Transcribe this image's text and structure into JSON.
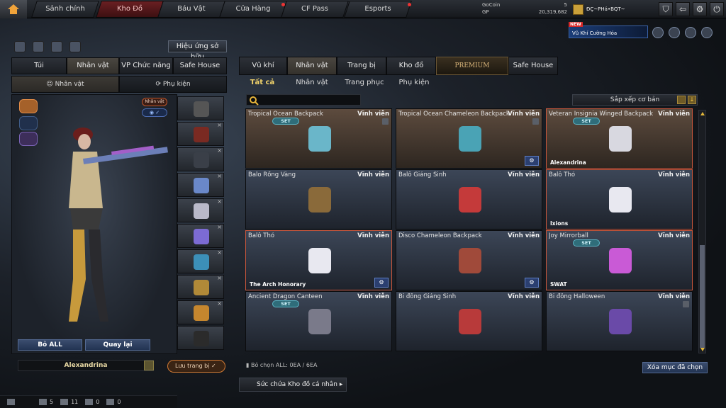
{
  "top_nav": {
    "tabs": [
      "Sảnh chính",
      "Kho Đồ",
      "Báu Vật",
      "Cửa Hàng",
      "CF Pass",
      "Esports"
    ],
    "active_tab": "Kho Đồ",
    "currency": {
      "gocoin_label": "GoCoin",
      "gocoin_value": "5",
      "gp_label": "GP",
      "gp_value": "20,319,682"
    },
    "clan": "ĐÇ~PHá•BQT~"
  },
  "promo": {
    "new_label": "NEW",
    "text": "Vũ Khí Cường Hóa"
  },
  "left_panel": {
    "effect_button": "Hiệu ứng sở hữu",
    "tabs": [
      "Túi",
      "Nhân vật",
      "VP Chức năng",
      "Safe House"
    ],
    "active_tab": "Nhân vật",
    "sub_tabs": [
      "Nhân vật",
      "Phụ kiện"
    ],
    "active_sub_tab": "Nhân vật",
    "tag_character": "Nhân vật",
    "bo_all": "Bỏ ALL",
    "quay_lai": "Quay lại",
    "character_name": "Alexandrina",
    "save_set": "Lưu trang bị"
  },
  "right_panel": {
    "tabs": [
      "Vũ khí",
      "Nhân vật",
      "Trang bị",
      "Kho đồ",
      "PREMIUM",
      "Safe House"
    ],
    "active_tab": "Nhân vật",
    "sub_tabs": [
      "Tất cả",
      "Nhân vật",
      "Trang phục",
      "Phụ kiện"
    ],
    "active_sub_tab": "Tất cả",
    "sort_label": "Sắp xếp cơ bản",
    "items": [
      {
        "name": "Tropical Ocean Backpack",
        "duration": "Vĩnh viễn",
        "set": "SET",
        "owner": "",
        "gear": false,
        "trash": true,
        "hl": false
      },
      {
        "name": "Tropical Ocean Chameleon Backpack",
        "duration": "Vĩnh viễn",
        "set": "",
        "owner": "",
        "gear": true,
        "trash": true,
        "hl": false
      },
      {
        "name": "Veteran Insignia Winged Backpack",
        "duration": "Vĩnh viễn",
        "set": "SET",
        "owner": "Alexandrina",
        "gear": false,
        "trash": false,
        "hl": true
      },
      {
        "name": "Balo Rồng Vàng",
        "duration": "Vĩnh viễn",
        "set": "",
        "owner": "",
        "gear": false,
        "trash": false,
        "hl": false
      },
      {
        "name": "Balô Giáng Sinh",
        "duration": "Vĩnh viễn",
        "set": "",
        "owner": "",
        "gear": false,
        "trash": false,
        "hl": false
      },
      {
        "name": "Balô Thỏ",
        "duration": "Vĩnh viễn",
        "set": "",
        "owner": "Ixions",
        "gear": false,
        "trash": false,
        "hl": true
      },
      {
        "name": "Balô Thỏ",
        "duration": "Vĩnh viễn",
        "set": "",
        "owner": "The Arch Honorary",
        "gear": true,
        "trash": false,
        "hl": true
      },
      {
        "name": "Disco Chameleon Backpack",
        "duration": "Vĩnh viễn",
        "set": "",
        "owner": "",
        "gear": true,
        "trash": false,
        "hl": false
      },
      {
        "name": "Joy Mirrorball",
        "duration": "Vĩnh viễn",
        "set": "SET",
        "owner": "SWAT",
        "gear": false,
        "trash": false,
        "hl": true
      },
      {
        "name": "Ancient Dragon Canteen",
        "duration": "Vĩnh viễn",
        "set": "SET",
        "owner": "",
        "gear": false,
        "trash": false,
        "hl": false
      },
      {
        "name": "Bi đông Giáng Sinh",
        "duration": "Vĩnh viễn",
        "set": "",
        "owner": "",
        "gear": false,
        "trash": false,
        "hl": false
      },
      {
        "name": "Bi đông Halloween",
        "duration": "Vĩnh viễn",
        "set": "",
        "owner": "",
        "gear": false,
        "trash": true,
        "hl": false
      }
    ],
    "unselect_text": "Bỏ chọn ALL: 0EA / 6EA",
    "clear_button": "Xóa mục đã chọn",
    "capacity": "Sức chứa Kho đồ cá nhân"
  },
  "bottom_bar": {
    "v1": "5",
    "v2": "11",
    "v3": "0",
    "v4": "0"
  }
}
